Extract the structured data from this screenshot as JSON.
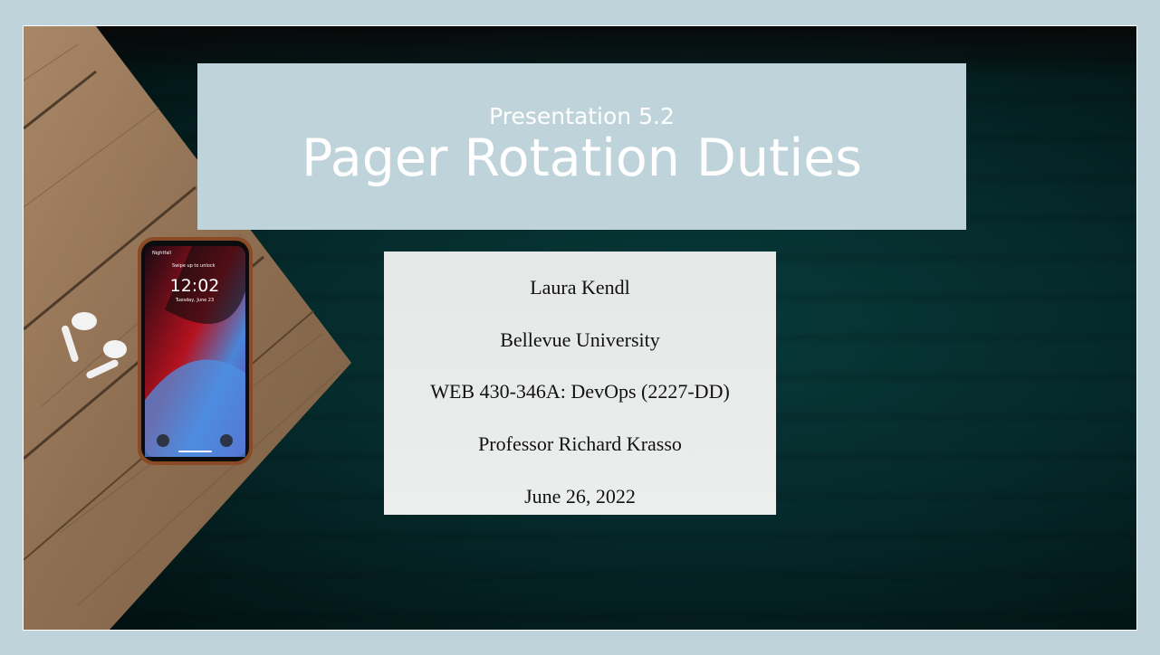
{
  "title_block": {
    "subtitle": "Presentation 5.2",
    "title": "Pager Rotation Duties"
  },
  "info_block": {
    "lines": [
      "Laura Kendl",
      "Bellevue University",
      "WEB 430-346A: DevOps (2227-DD)",
      "Professor Richard Krasso",
      "June 26, 2022"
    ]
  },
  "phone": {
    "lock_text": "Swipe up to unlock",
    "time": "12:02",
    "date": "Tuesday, June 23",
    "carrier": "Nightfall"
  },
  "colors": {
    "slide_frame": "#bfd3da",
    "title_box": "#bfd3da",
    "title_text": "#ffffff",
    "info_box": "#eaecec",
    "background": "#052a2b"
  },
  "icons": [
    "flashlight-icon",
    "camera-icon",
    "lock-icon",
    "airpods-icon"
  ]
}
